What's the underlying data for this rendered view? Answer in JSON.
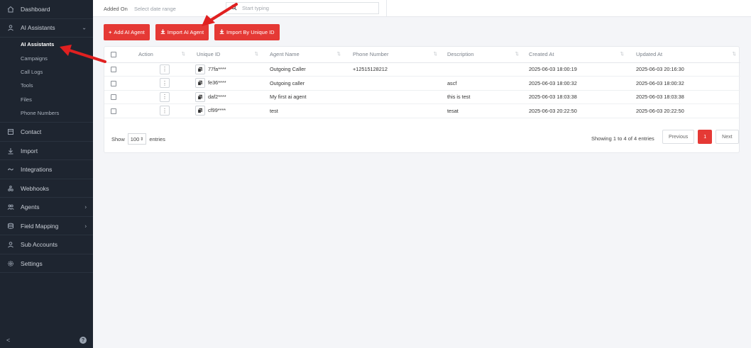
{
  "sidebar": {
    "items": [
      {
        "label": "Dashboard",
        "icon": "home-icon"
      },
      {
        "label": "AI Assistants",
        "icon": "user-icon",
        "expanded": true,
        "children": [
          "AI Assistants",
          "Campaigns",
          "Call Logs",
          "Tools",
          "Files",
          "Phone Numbers"
        ]
      },
      {
        "label": "Contact",
        "icon": "contact-icon"
      },
      {
        "label": "Import",
        "icon": "download-icon"
      },
      {
        "label": "Integrations",
        "icon": "link-icon"
      },
      {
        "label": "Webhooks",
        "icon": "webhook-icon"
      },
      {
        "label": "Agents",
        "icon": "users-icon"
      },
      {
        "label": "Field Mapping",
        "icon": "database-icon"
      },
      {
        "label": "Sub Accounts",
        "icon": "user-icon"
      },
      {
        "label": "Settings",
        "icon": "gear-icon"
      }
    ],
    "active_child": "AI Assistants",
    "collapse_glyph": "<",
    "help_glyph": "?"
  },
  "filter": {
    "label": "Added On",
    "date_placeholder": "Select date range",
    "search_placeholder": "Start typing"
  },
  "buttons": {
    "add": "Add AI Agent",
    "import": "Import AI Agent",
    "import_unique": "Import By Unique ID"
  },
  "table": {
    "headers": [
      "Action",
      "Unique ID",
      "Agent Name",
      "Phone Number",
      "Description",
      "Created At",
      "Updated At"
    ],
    "rows": [
      {
        "unique_id": "77fa****",
        "agent_name": "Outgoing Caller",
        "phone": "+12515128212",
        "description": "",
        "created": "2025-06-03 18:00:19",
        "updated": "2025-06-03 20:16:30"
      },
      {
        "unique_id": "fe36****",
        "agent_name": "Outgoing caller",
        "phone": "",
        "description": "ascf",
        "created": "2025-06-03 18:00:32",
        "updated": "2025-06-03 18:00:32"
      },
      {
        "unique_id": "daf2****",
        "agent_name": "My first ai agent",
        "phone": "",
        "description": "this is test",
        "created": "2025-06-03 18:03:38",
        "updated": "2025-06-03 18:03:38"
      },
      {
        "unique_id": "cf99****",
        "agent_name": "test",
        "phone": "",
        "description": "tesat",
        "created": "2025-06-03 20:22:50",
        "updated": "2025-06-03 20:22:50"
      }
    ]
  },
  "footer": {
    "show_label": "Show",
    "page_size": "100",
    "entries_label": "entries",
    "info": "Showing 1 to 4 of 4 entries",
    "previous": "Previous",
    "current_page": "1",
    "next": "Next"
  },
  "colors": {
    "accent": "#e53935",
    "sidebar_bg": "#1e2530"
  }
}
